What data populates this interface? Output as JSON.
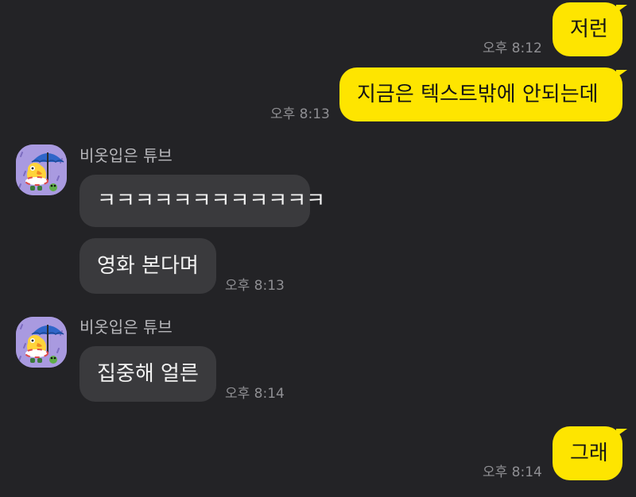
{
  "messages": [
    {
      "text": "저런",
      "time": "오후 8:12"
    },
    {
      "text": "지금은 텍스트밖에 안되는데",
      "time": "오후 8:13"
    },
    {
      "text": "ㅋㅋㅋㅋㅋㅋㅋㅋㅋㅋㅋㅋ"
    },
    {
      "text": "영화 본다며",
      "time": "오후 8:13"
    },
    {
      "text": "집중해 얼른",
      "time": "오후 8:14"
    },
    {
      "text": "그래",
      "time": "오후 8:14"
    }
  ],
  "senders": [
    {
      "name": "비옷입은 튜브",
      "avatar_icon": "tube-umbrella-avatar-icon"
    },
    {
      "name": "비옷입은 튜브",
      "avatar_icon": "tube-umbrella-avatar-icon"
    }
  ],
  "colors": {
    "background": "#232326",
    "my_bubble": "#fee500",
    "other_bubble": "#3a3a3d",
    "avatar_bg": "#a99ae0"
  }
}
